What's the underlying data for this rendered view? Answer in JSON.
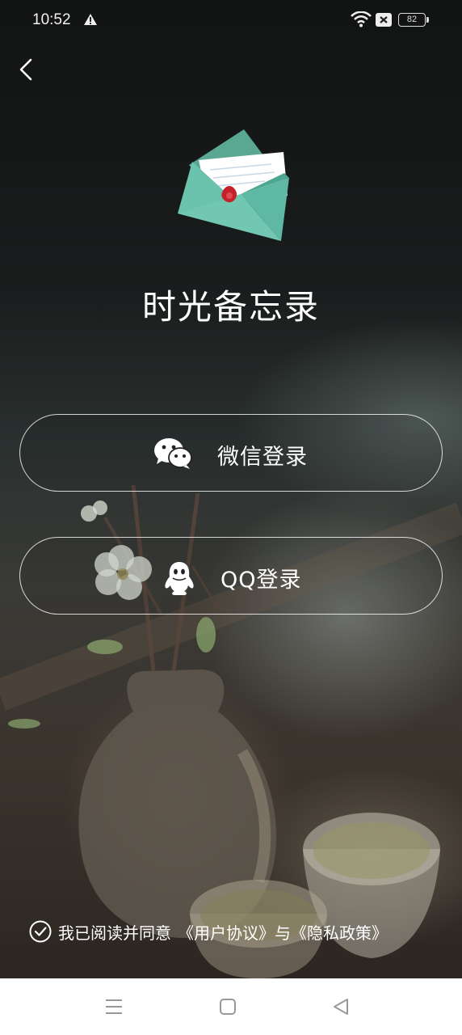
{
  "status_bar": {
    "time": "10:52",
    "battery": "82",
    "icons": [
      "alert-icon",
      "wifi-icon",
      "sim-off-icon",
      "battery-icon"
    ]
  },
  "nav": {
    "back_icon": "chevron-left-icon"
  },
  "app": {
    "title": "时光备忘录",
    "logo_icon": "envelope-letter-icon"
  },
  "login": {
    "wechat_label": "微信登录",
    "wechat_icon": "wechat-icon",
    "qq_label": "QQ登录",
    "qq_icon": "qq-penguin-icon"
  },
  "agreement": {
    "prefix": "我已阅读并同意",
    "user_agreement": "《用户协议》",
    "connector": "与",
    "privacy_policy": "《隐私政策》",
    "checked": true
  },
  "system_nav": {
    "menu_icon": "menu-icon",
    "home_icon": "square-home-icon",
    "back_icon": "triangle-back-icon"
  },
  "colors": {
    "envelope": "#5fb8a4",
    "seal": "#c3222b",
    "button_border": "#ffffff"
  }
}
